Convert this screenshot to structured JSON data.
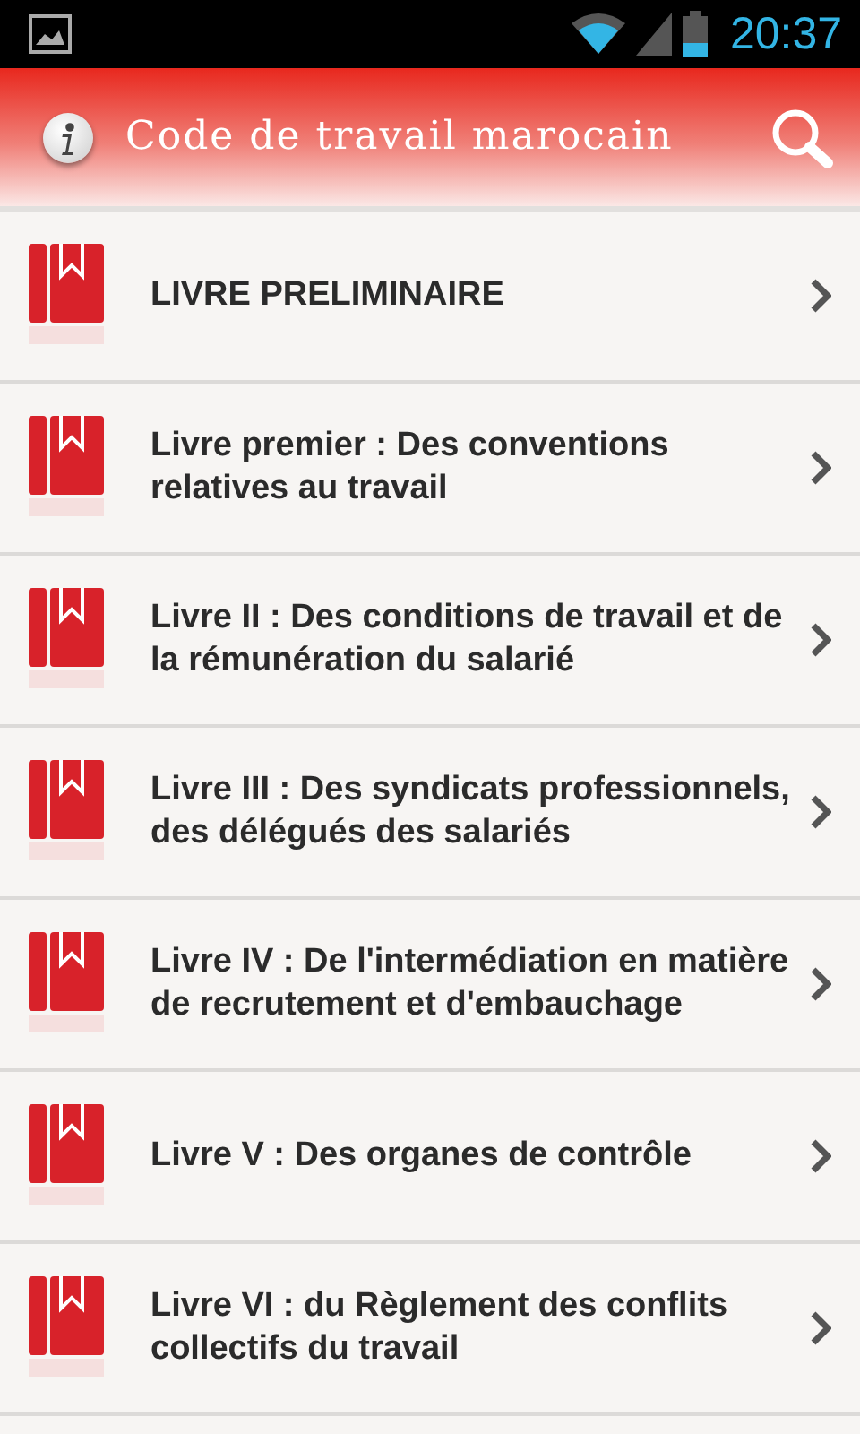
{
  "status_bar": {
    "time": "20:37"
  },
  "header": {
    "title": "Code de travail marocain"
  },
  "items": [
    {
      "label": "LIVRE PRELIMINAIRE"
    },
    {
      "label": "Livre premier : Des conventions relatives au travail"
    },
    {
      "label": "Livre II : Des conditions de travail et de la rémunération du salarié"
    },
    {
      "label": "Livre III : Des syndicats professionnels, des délégués des salariés"
    },
    {
      "label": "Livre IV : De l'intermédiation en matière de recrutement et d'embauchage"
    },
    {
      "label": "Livre V : Des organes de contrôle"
    },
    {
      "label": "Livre VI : du Règlement des conflits collectifs du travail"
    }
  ]
}
